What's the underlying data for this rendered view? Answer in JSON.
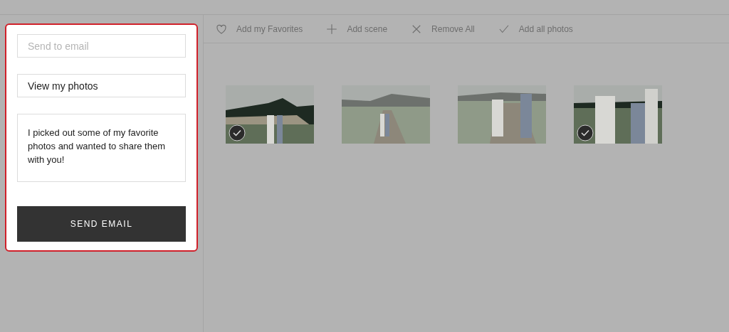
{
  "email_form": {
    "email": {
      "placeholder": "Send to email"
    },
    "subject": {
      "value": "View my photos"
    },
    "message": {
      "value": "I picked out some of my favorite photos and wanted to share them with you!"
    },
    "send_button": "SEND EMAIL"
  },
  "toolbar": [
    {
      "kind": "heart",
      "label": "Add my Favorites"
    },
    {
      "kind": "plus",
      "label": "Add scene"
    },
    {
      "kind": "cross",
      "label": "Remove All"
    },
    {
      "kind": "check",
      "label": "Add all photos"
    }
  ],
  "photos": [
    {
      "selected": true
    },
    {
      "selected": false
    },
    {
      "selected": false
    },
    {
      "selected": true
    }
  ]
}
